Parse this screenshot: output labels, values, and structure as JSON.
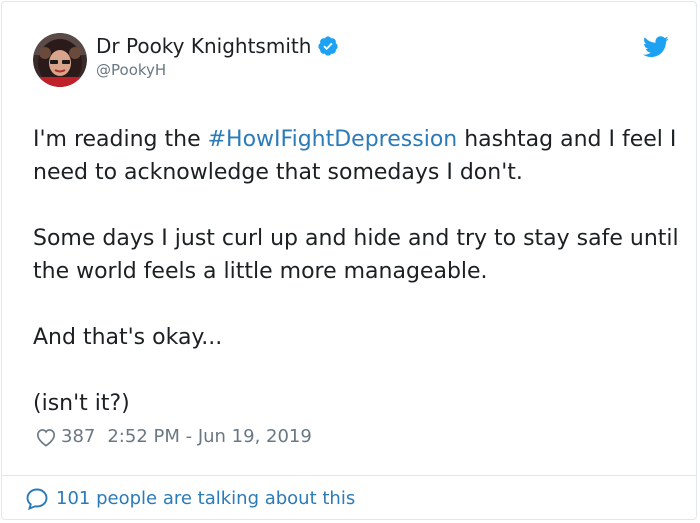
{
  "author": {
    "name": "Dr Pooky Knightsmith",
    "handle": "@PookyH",
    "avatar_icon": "user-avatar-photo",
    "verified_icon": "verified-badge-icon"
  },
  "brand": {
    "icon": "twitter-bird-icon",
    "color": "#1da1f2"
  },
  "tweet": {
    "p1_before": "I'm reading the ",
    "hashtag": "#HowIFightDepression",
    "p1_after": " hashtag and I feel I need to acknowledge that somedays I don't.",
    "p2": "Some days I just curl up and hide and try to stay safe until the world feels a little more manageable.",
    "p3": "And that's okay...",
    "p4": "(isn't it?)"
  },
  "meta": {
    "likes": "387",
    "timestamp": "2:52 PM - Jun 19, 2019",
    "heart_icon": "heart-outline-icon"
  },
  "footer": {
    "talk_label": "101 people are talking about this",
    "bubble_icon": "speech-bubble-icon"
  },
  "colors": {
    "text": "#1c2022",
    "secondary": "#697882",
    "link": "#2b7bb9",
    "border": "#e1e8ed"
  }
}
